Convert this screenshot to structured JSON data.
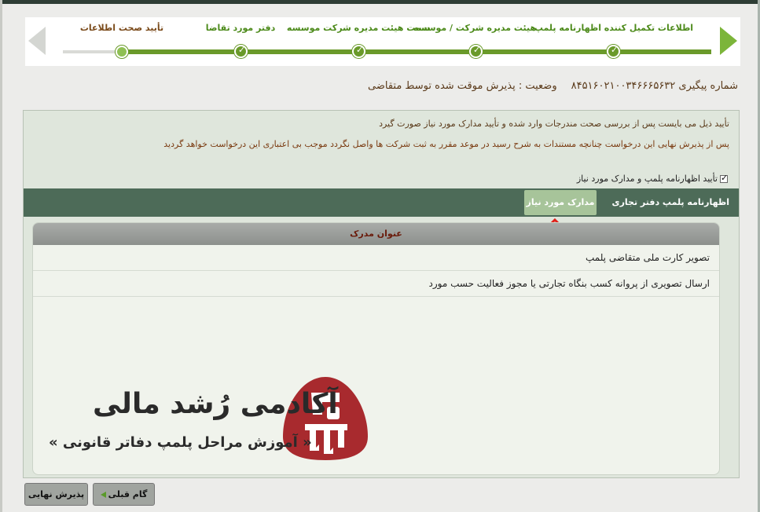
{
  "wizard": {
    "steps": [
      {
        "label": "اطلاعات تکمیل کننده اظهارنامه پلمپ",
        "state": "done"
      },
      {
        "label": "هیئت مدیره شرکت / موسسه",
        "state": "done"
      },
      {
        "label": "سمت هیئت مدیره شرکت موسسه",
        "state": "done"
      },
      {
        "label": "دفتر مورد تقاضا",
        "state": "done"
      },
      {
        "label": "تأیید صحت اطلاعات",
        "state": "current"
      }
    ]
  },
  "tracking": {
    "number_text": "شماره پیگیری ۸۴۵۱۶۰۲۱۰۰۳۴۶۶۶۵۶۳۲",
    "status_text": "وضعیت : پذیرش موقت شده توسط متقاضی"
  },
  "notes": {
    "line1": "تأیید ذیل می بایست پس از بررسی صحت مندرجات وارد شده و تأیید مدارک مورد نیاز صورت گیرد",
    "line2": "پس از پذیرش نهایی این درخواست چنانچه مستندات به شرح رسید در موعد مقرر به ثبت شرکت ها واصل نگردد موجب بی اعتباری این درخواست خواهد گردید"
  },
  "confirm_checkbox": {
    "label": "تأیید اظهارنامه پلمپ و مدارک مورد نیاز",
    "checked": true
  },
  "tabs": [
    {
      "label": "اظهارنامه پلمپ دفتر تجاری",
      "active": false
    },
    {
      "label": "مدارک مورد نیاز",
      "active": true
    }
  ],
  "documents": {
    "header": "عنوان مدرک",
    "rows": [
      "تصویر کارت ملی متقاضی پلمپ",
      "ارسال تصویری از پروانه کسب بنگاه تجارتی یا مجوز فعالیت حسب مورد"
    ]
  },
  "watermark": {
    "title": "آکادمی رُشد مالی",
    "subtitle": "« آموزش مراحل پلمپ دفاتر قانونی »"
  },
  "buttons": {
    "previous": "گام قبلی",
    "final_accept": "پذیرش نهایی"
  },
  "colors": {
    "accent_green": "#6a9a2a",
    "tab_bar": "#4d6b58",
    "active_tab": "#a7c49a",
    "highlight_arrow": "#e0201a"
  }
}
